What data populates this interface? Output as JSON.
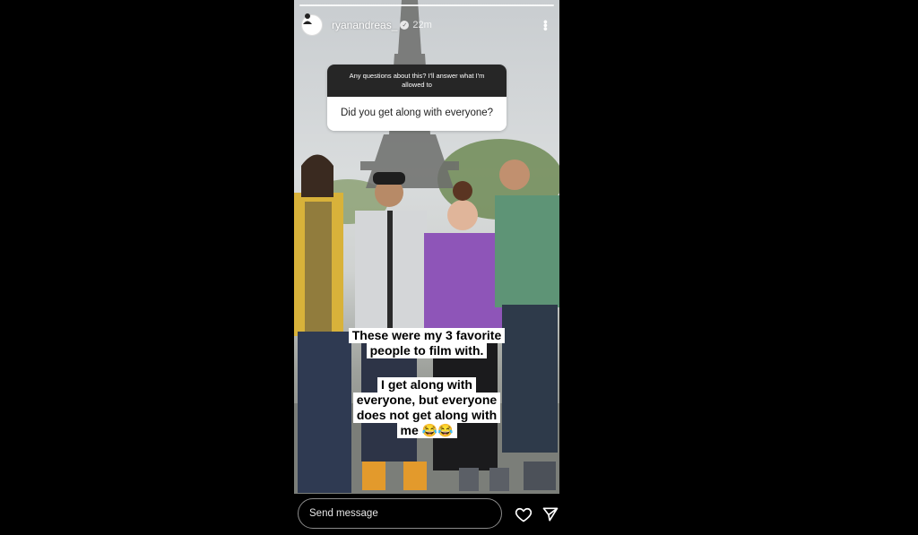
{
  "story": {
    "username": "ryanandreas_",
    "time": "22m",
    "progress": 1.0
  },
  "question": {
    "prompt": "Any questions about this? I'll answer what I'm allowed to",
    "asked": "Did you get along with everyone?"
  },
  "caption1": {
    "lines": [
      "These were my 3 favorite",
      "people to film with."
    ]
  },
  "caption2": {
    "lines": [
      "I get along with",
      "everyone, but everyone",
      "does not get along with",
      "me 😂😂"
    ]
  },
  "reply": {
    "placeholder": "Send message"
  },
  "icons": {
    "avatar": "avatar-icon",
    "verified": "verified-badge-icon",
    "more": "more-options-icon",
    "like": "heart-icon",
    "share": "paper-plane-icon"
  }
}
